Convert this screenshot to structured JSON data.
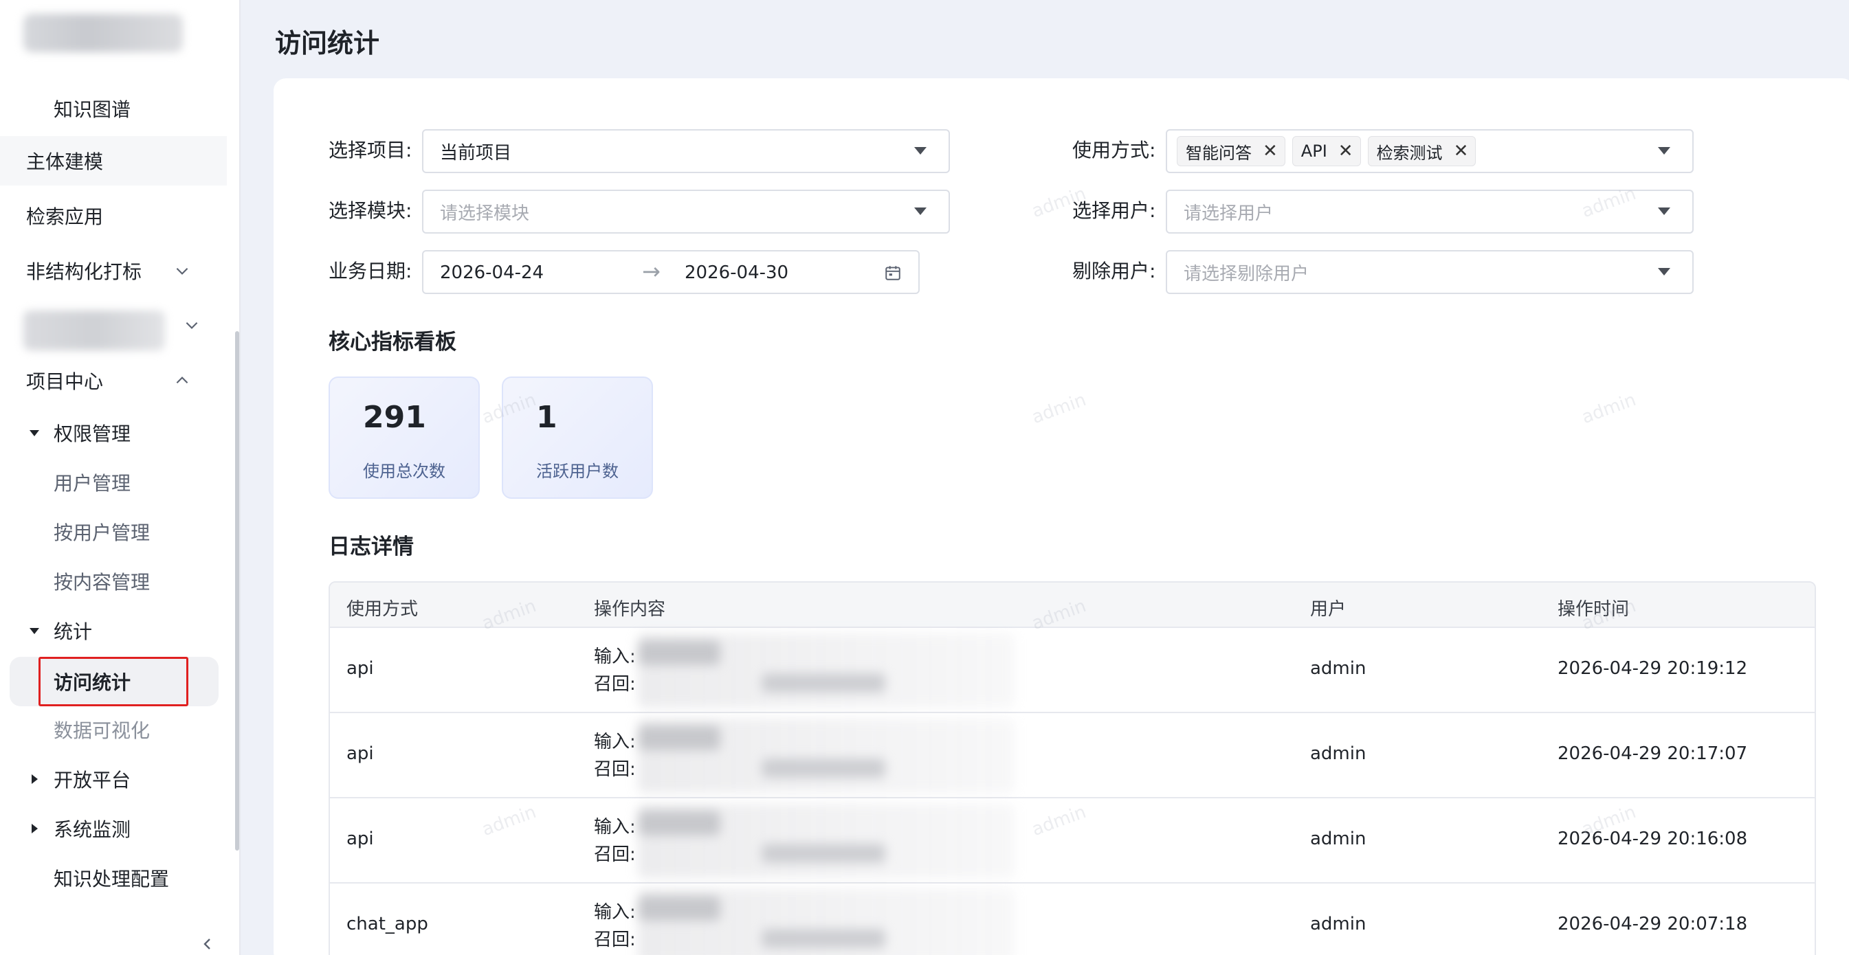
{
  "page": {
    "title": "访问统计"
  },
  "sidebar": {
    "items": [
      {
        "label": "知识图谱"
      },
      {
        "label": "主体建模"
      },
      {
        "label": "检索应用"
      },
      {
        "label": "非结构化打标"
      },
      {
        "label": "项目中心"
      },
      {
        "label": "权限管理"
      },
      {
        "label": "用户管理"
      },
      {
        "label": "按用户管理"
      },
      {
        "label": "按内容管理"
      },
      {
        "label": "统计"
      },
      {
        "label": "访问统计"
      },
      {
        "label": "数据可视化"
      },
      {
        "label": "开放平台"
      },
      {
        "label": "系统监测"
      },
      {
        "label": "知识处理配置"
      }
    ]
  },
  "filters": {
    "project": {
      "label": "选择项目:",
      "value": "当前项目"
    },
    "usage": {
      "label": "使用方式:",
      "tags": [
        "智能问答",
        "API",
        "检索测试"
      ],
      "remove_glyph": "✕"
    },
    "module": {
      "label": "选择模块:",
      "placeholder": "请选择模块"
    },
    "user": {
      "label": "选择用户:",
      "placeholder": "请选择用户"
    },
    "date": {
      "label": "业务日期:",
      "start": "2026-04-24",
      "end": "2026-04-30",
      "separator": "→"
    },
    "exclude": {
      "label": "剔除用户:",
      "placeholder": "请选择剔除用户"
    }
  },
  "dashboard": {
    "title": "核心指标看板",
    "metrics": [
      {
        "value": "291",
        "label": "使用总次数"
      },
      {
        "value": "1",
        "label": "活跃用户数"
      }
    ]
  },
  "logs": {
    "title": "日志详情",
    "columns": [
      "使用方式",
      "操作内容",
      "用户",
      "操作时间"
    ],
    "rows": [
      {
        "method": "api",
        "input": "输入:",
        "recall": "召回:",
        "user": "admin",
        "time": "2026-04-29 20:19:12"
      },
      {
        "method": "api",
        "input": "输入:",
        "recall": "召回:",
        "user": "admin",
        "time": "2026-04-29 20:17:07"
      },
      {
        "method": "api",
        "input": "输入:",
        "recall": "召回:",
        "user": "admin",
        "time": "2026-04-29 20:16:08"
      },
      {
        "method": "chat_app",
        "input": "输入:",
        "recall": "召回:",
        "user": "admin",
        "time": "2026-04-29 20:07:18"
      }
    ]
  },
  "watermark": "admin",
  "colors": {
    "accent_highlight": "#e02020",
    "metric_label": "#4d6290",
    "background": "#eef1f8"
  }
}
